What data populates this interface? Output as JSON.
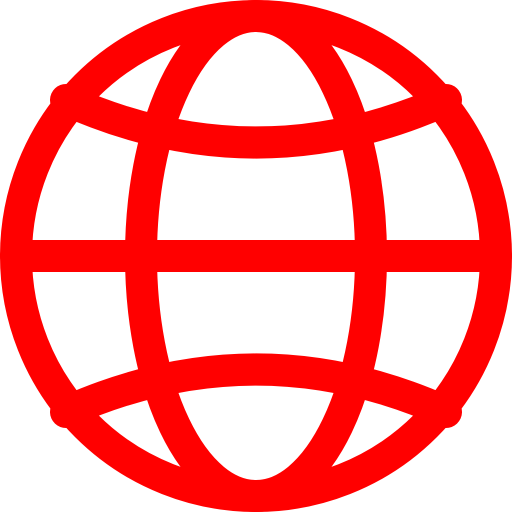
{
  "icon": {
    "name": "globe-icon",
    "color": "#ff0000",
    "background": "#ffffff"
  }
}
